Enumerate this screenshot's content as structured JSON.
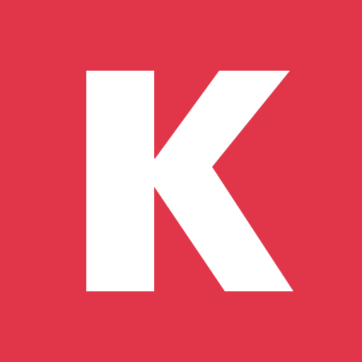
{
  "app_icon": {
    "letter": "K",
    "background_color": "#e1364a",
    "foreground_color": "#ffffff",
    "glyph": "letter-k-logo"
  }
}
